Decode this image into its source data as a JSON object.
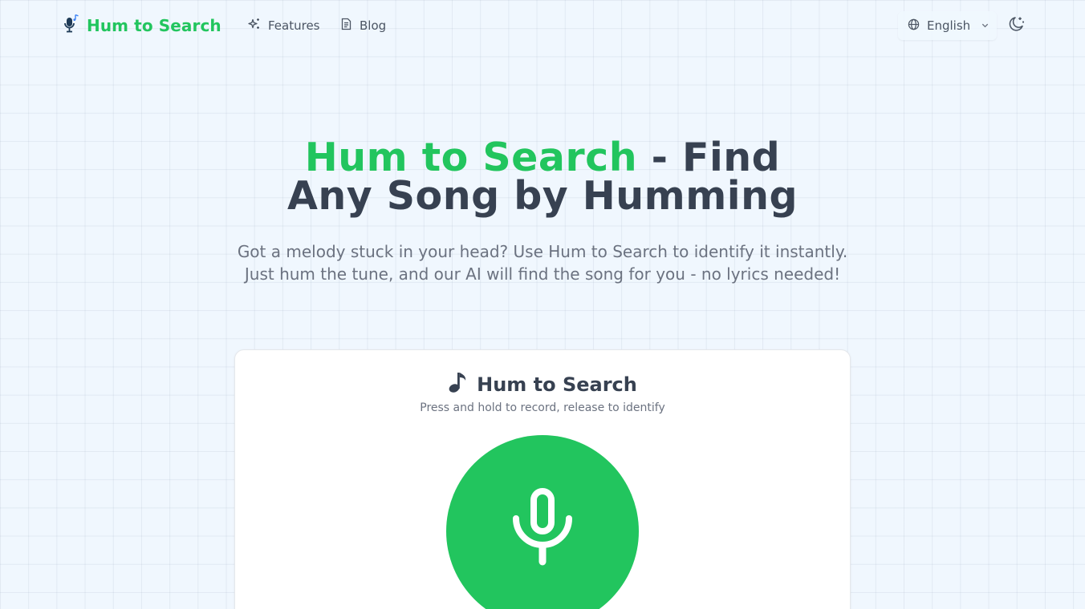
{
  "nav": {
    "brand": "Hum to Search",
    "links": [
      {
        "label": "Features",
        "icon": "sparkles-icon"
      },
      {
        "label": "Blog",
        "icon": "document-icon"
      }
    ],
    "language": {
      "label": "English",
      "icon": "globe-icon"
    },
    "theme_toggle_icon": "moon-icon"
  },
  "hero": {
    "title_accent": "Hum to Search",
    "title_rest_line1": " - Find",
    "title_line2": "Any Song by Humming",
    "subtitle_line1": "Got a melody stuck in your head? Use Hum to Search to identify it instantly.",
    "subtitle_line2": "Just hum the tune, and our AI will find the song for you - no lyrics needed!"
  },
  "recorder": {
    "title": "Hum to Search",
    "title_icon": "music-note-icon",
    "instruction": "Press and hold to record, release to identify",
    "button_icon": "microphone-icon"
  },
  "colors": {
    "accent": "#22c55e",
    "heading": "#374151",
    "muted": "#6b7280",
    "background": "#f0f7fe"
  }
}
